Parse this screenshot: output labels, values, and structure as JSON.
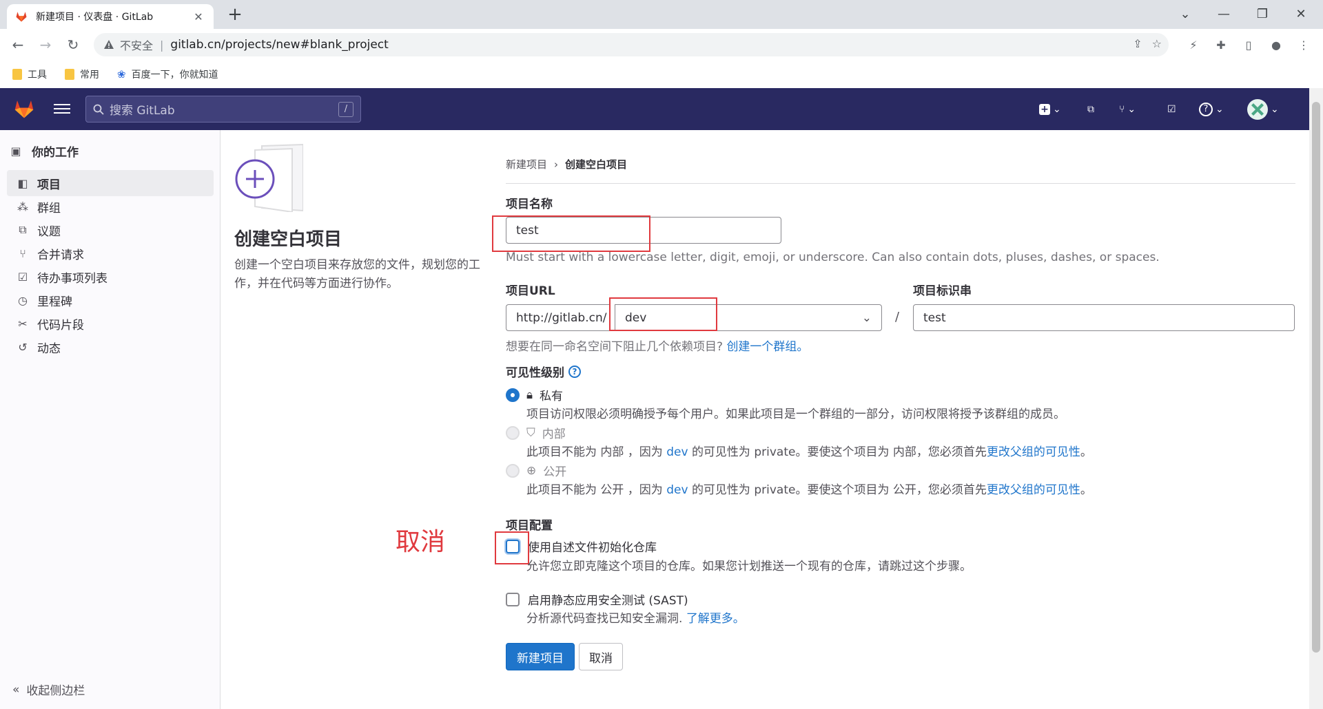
{
  "browser": {
    "tab_title": "新建项目 · 仪表盘 · GitLab",
    "security_label": "不安全",
    "url": "gitlab.cn/projects/new#blank_project",
    "bookmarks": [
      "工具",
      "常用",
      "百度一下，你就知道"
    ]
  },
  "header": {
    "search_placeholder": "搜索 GitLab",
    "search_shortcut": "/"
  },
  "sidebar": {
    "title": "你的工作",
    "items": [
      {
        "label": "项目",
        "icon": "project-icon",
        "active": true
      },
      {
        "label": "群组",
        "icon": "group-icon",
        "active": false
      },
      {
        "label": "议题",
        "icon": "issues-icon",
        "active": false
      },
      {
        "label": "合并请求",
        "icon": "merge-request-icon",
        "active": false
      },
      {
        "label": "待办事项列表",
        "icon": "todo-icon",
        "active": false
      },
      {
        "label": "里程碑",
        "icon": "milestone-icon",
        "active": false
      },
      {
        "label": "代码片段",
        "icon": "snippet-icon",
        "active": false
      },
      {
        "label": "动态",
        "icon": "activity-icon",
        "active": false
      }
    ],
    "collapse_label": "收起侧边栏"
  },
  "intro": {
    "title": "创建空白项目",
    "description": "创建一个空白项目来存放您的文件，规划您的工作，并在代码等方面进行协作。"
  },
  "breadcrumb": {
    "parent": "新建项目",
    "current": "创建空白项目"
  },
  "form": {
    "name_label": "项目名称",
    "name_value": "test",
    "name_help": "Must start with a lowercase letter, digit, emoji, or underscore. Can also contain dots, pluses, dashes, or spaces.",
    "url_label": "项目URL",
    "url_prefix": "http://gitlab.cn/",
    "namespace_value": "dev",
    "slug_label": "项目标识串",
    "slug_value": "test",
    "group_help": "想要在同一命名空间下阻止几个依赖项目?",
    "group_link": "创建一个群组。",
    "visibility_label": "可见性级别",
    "visibility": [
      {
        "label": "私有",
        "desc_pre": "项目访问权限必须明确授予每个用户。如果此项目是一个群组的一部分，访问权限将授予该群组的成员。"
      },
      {
        "label": "内部",
        "desc_pre": "此项目不能为 内部 ，因为",
        "desc_group": "dev",
        "desc_mid": "的可见性为 private。要使这个项目为 内部，您必须首先",
        "desc_link": "更改父组的可见性"
      },
      {
        "label": "公开",
        "desc_pre": "此项目不能为 公开 ，因为",
        "desc_group": "dev",
        "desc_mid": "的可见性为 private。要使这个项目为 公开，您必须首先",
        "desc_link": "更改父组的可见性"
      }
    ],
    "config_label": "项目配置",
    "readme_label": "使用自述文件初始化仓库",
    "readme_desc": "允许您立即克隆这个项目的仓库。如果您计划推送一个现有的仓库，请跳过这个步骤。",
    "sast_label": "启用静态应用安全测试 (SAST)",
    "sast_desc": "分析源代码查找已知安全漏洞.",
    "sast_link": "了解更多。",
    "submit_label": "新建项目",
    "cancel_label": "取消"
  },
  "annotation": {
    "text": "取消",
    "color": "#e0393e"
  },
  "colors": {
    "header_bg": "#292961",
    "primary": "#1f75cb"
  }
}
